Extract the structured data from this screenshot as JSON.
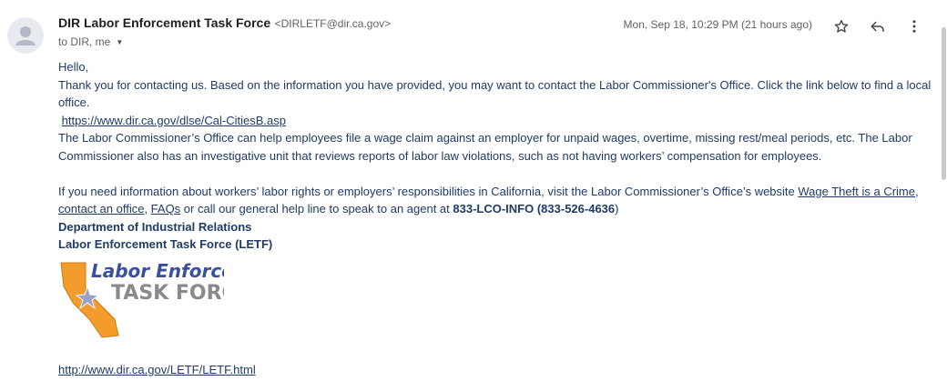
{
  "email": {
    "sender_name": "DIR Labor Enforcement Task Force",
    "sender_email": "<DIRLETF@dir.ca.gov>",
    "recipients": "to DIR, me",
    "date": "Mon, Sep 18, 10:29 PM (21 hours ago)"
  },
  "icons": {
    "avatar": "person-icon",
    "star": "star-outline-icon",
    "reply": "reply-icon",
    "more": "more-vert-icon",
    "caret": "caret-down-icon"
  },
  "body": {
    "greeting": "Hello,",
    "para1": "Thank you for contacting us. Based on the information you have provided, you may want to contact the Labor Commissioner's Office. Click the link below to find a local office.",
    "link1": "https://www.dir.ca.gov/dlse/Cal-CitiesB.asp",
    "para2": "The Labor Commissioner’s Office can help employees file a wage claim against an employer for unpaid wages, overtime, missing rest/meal periods, etc. The Labor Commissioner also has an investigative unit that reviews reports of labor law violations, such as not having workers’ compensation for employees.",
    "para3_intro": "If you need information about workers’ labor rights or employers’ responsibilities in California, visit the Labor Commissioner’s Office’s website ",
    "link_wage_theft": "Wage Theft is a Crime",
    "sep1": ", ",
    "link_contact": "contact an office",
    "sep2": ", ",
    "link_faqs": "FAQs",
    "para3_mid": " or call our general help line to speak to an agent at ",
    "phone": "833-LCO-INFO (833-526-4636",
    "para3_end": ")",
    "sig_dept": "Department of Industrial Relations",
    "sig_letf": "Labor Enforcement Task Force (LETF)",
    "logo_line1": "Labor Enforcement",
    "logo_line2": "TASK FORCE",
    "link_letf": "http://www.dir.ca.gov/LETF/LETF.html"
  },
  "colors": {
    "link": "#1f3b66",
    "logo_blue": "#3a4fa0",
    "logo_gray": "#8a8a8a",
    "logo_orange": "#f39c2b"
  }
}
